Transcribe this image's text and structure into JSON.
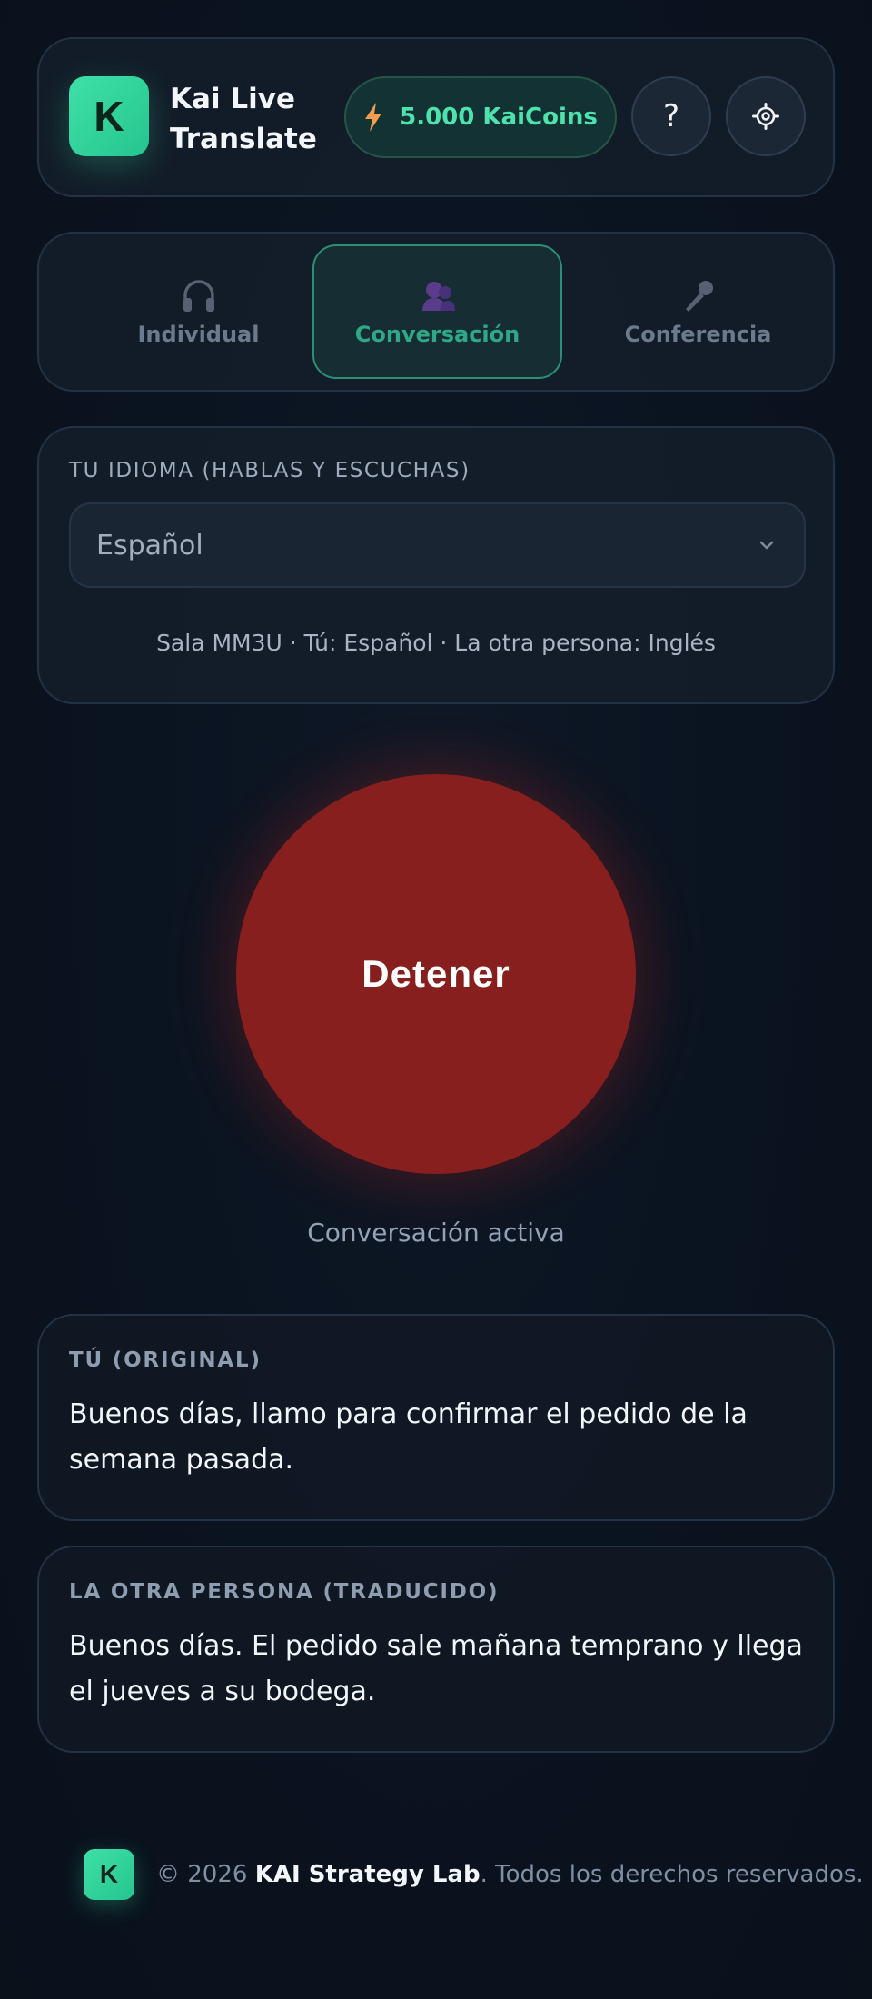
{
  "header": {
    "logo_letter": "K",
    "app_title": "Kai Live Translate",
    "coins_label": "5.000 KaiCoins",
    "help_label": "?",
    "accent_color": "#34d399"
  },
  "modes": {
    "tabs": [
      {
        "label": "Individual",
        "icon": "headphones-icon",
        "active": false
      },
      {
        "label": "Conversación",
        "icon": "people-icon",
        "active": true
      },
      {
        "label": "Conferencia",
        "icon": "microphone-icon",
        "active": false
      }
    ]
  },
  "language": {
    "label": "TU IDIOMA (HABLAS Y ESCUCHAS)",
    "selected": "Español",
    "room_info": "Sala MM3U · Tú: Español · La otra persona: Inglés"
  },
  "control": {
    "stop_label": "Detener",
    "status": "Conversación activa",
    "stop_color": "#861f1d"
  },
  "transcript": {
    "original_label": "TÚ (ORIGINAL)",
    "original_text": "Buenos días, llamo para confirmar el pedido de la semana pasada.",
    "translated_label": "LA OTRA PERSONA (TRADUCIDO)",
    "translated_text": "Buenos días. El pedido sale mañana temprano y llega el jueves a su bodega."
  },
  "footer": {
    "logo_letter": "K",
    "copyright": "© 2026 ",
    "brand": "KAI Strategy Lab",
    "rights": ". Todos los derechos reservados."
  }
}
